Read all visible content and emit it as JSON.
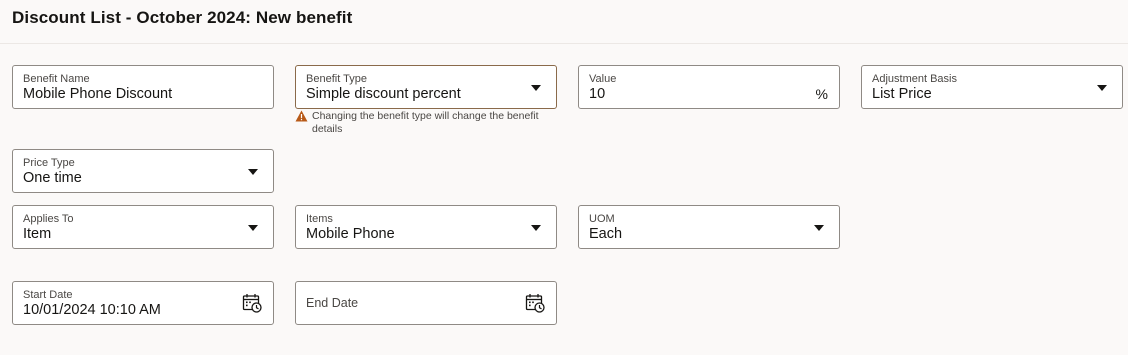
{
  "header": {
    "title": "Discount List - October 2024: New benefit"
  },
  "fields": {
    "benefit_name": {
      "label": "Benefit Name",
      "value": "Mobile Phone Discount"
    },
    "benefit_type": {
      "label": "Benefit Type",
      "value": "Simple discount percent"
    },
    "value": {
      "label": "Value",
      "value": "10",
      "suffix": "%"
    },
    "adjustment_basis": {
      "label": "Adjustment Basis",
      "value": "List Price"
    },
    "price_type": {
      "label": "Price Type",
      "value": "One time"
    },
    "applies_to": {
      "label": "Applies To",
      "value": "Item"
    },
    "items": {
      "label": "Items",
      "value": "Mobile Phone"
    },
    "uom": {
      "label": "UOM",
      "value": "Each"
    },
    "start_date": {
      "label": "Start Date",
      "value": "10/01/2024 10:10 AM"
    },
    "end_date": {
      "label": "End Date",
      "value": ""
    }
  },
  "warning": {
    "text": "Changing the benefit type will change the benefit details"
  },
  "icons": {
    "dropdown": "chevron-down-icon",
    "calendar": "calendar-icon",
    "warning": "warning-icon"
  },
  "colors": {
    "background": "#fbf9f8",
    "field_border": "#8f8a85",
    "focused_border": "#8a6a4a",
    "warning": "#b85a18"
  }
}
